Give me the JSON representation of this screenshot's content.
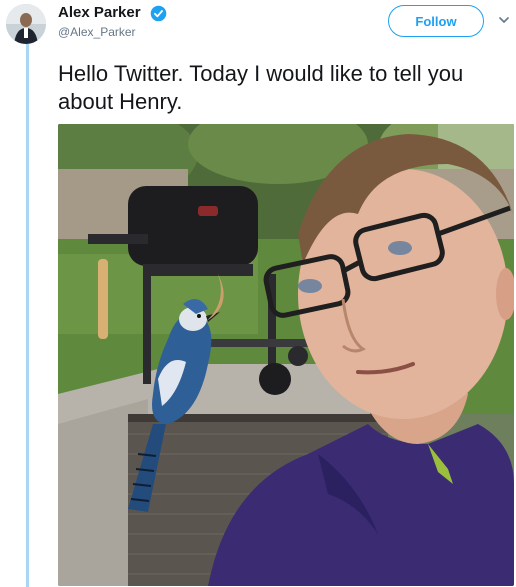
{
  "user": {
    "display_name": "Alex Parker",
    "handle": "@Alex_Parker",
    "verified": true,
    "avatar_icon": "user-avatar"
  },
  "header": {
    "follow_label": "Follow",
    "menu_icon": "chevron-down-icon"
  },
  "tweet": {
    "text": "Hello Twitter. Today I would like to tell you about Henry."
  },
  "colors": {
    "accent": "#1da1f2",
    "thread_line": "#a9d6f5",
    "secondary_text": "#657786"
  }
}
